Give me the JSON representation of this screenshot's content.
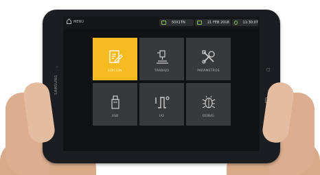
{
  "statusbar": {
    "menu_label": "MENÚ",
    "model": "50X1TN",
    "date": "21 FEB 2018",
    "time": "11:30:07"
  },
  "device": {
    "brand": "SAMSUNG"
  },
  "tiles": [
    {
      "label": "EDICIÓN",
      "icon": "edit-icon",
      "active": true
    },
    {
      "label": "TRABAJO",
      "icon": "machine-icon",
      "active": false
    },
    {
      "label": "PARÁMETROS",
      "icon": "tools-icon",
      "active": false
    },
    {
      "label": "USB",
      "icon": "usb-icon",
      "active": false
    },
    {
      "label": "I/O",
      "icon": "io-signal-icon",
      "active": false
    },
    {
      "label": "DEBUG",
      "icon": "bug-icon",
      "active": false
    }
  ],
  "colors": {
    "accent": "#f5bb21",
    "tile": "#38393b",
    "screen": "#111213",
    "status_icon": "#8bc34a"
  }
}
